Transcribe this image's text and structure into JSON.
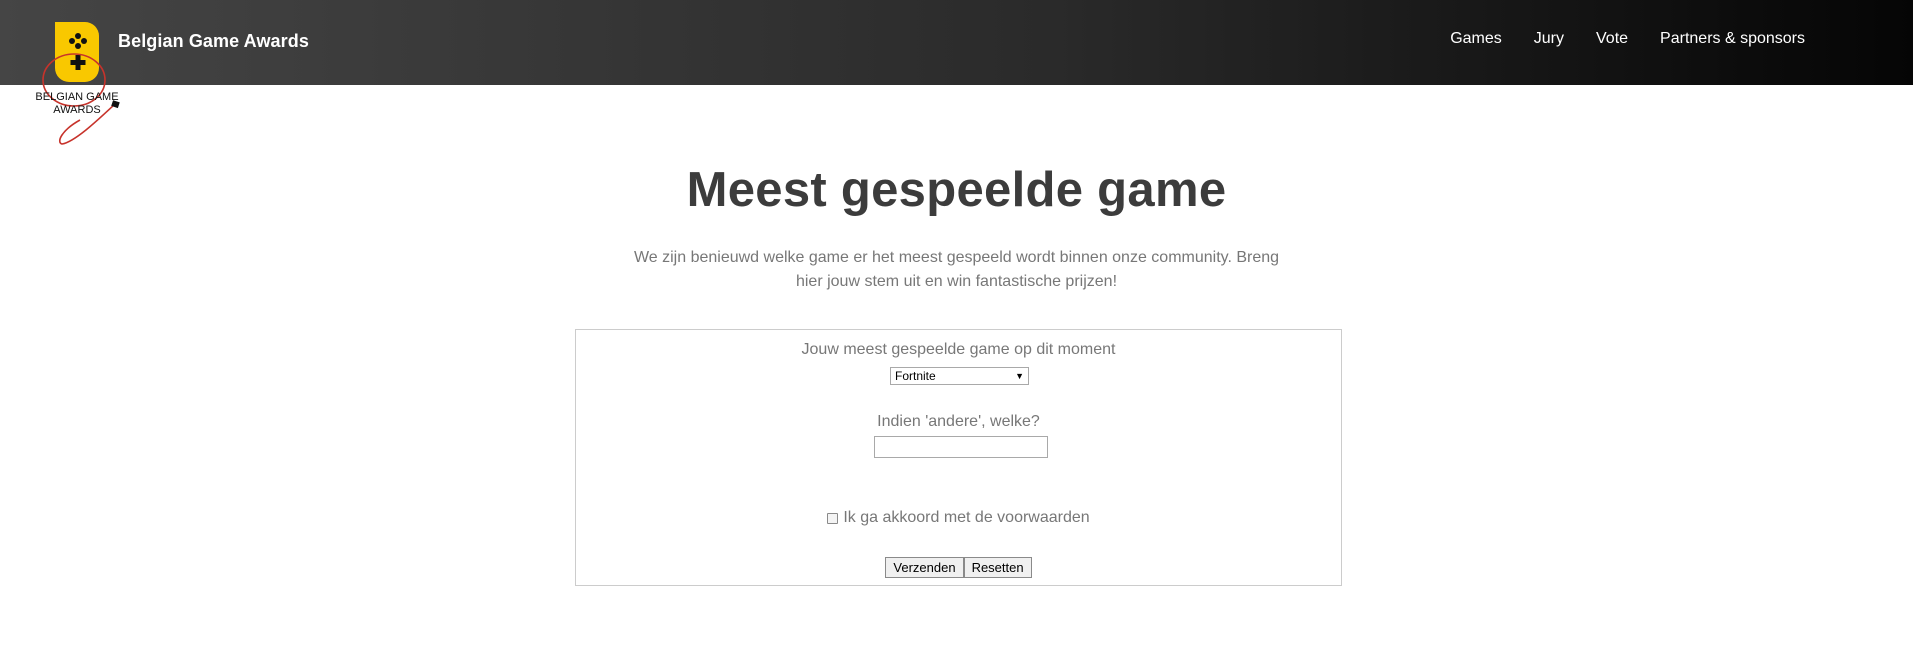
{
  "header": {
    "logo_text": "BELGIAN GAME AWARDS",
    "brand": "Belgian Game Awards",
    "nav": [
      "Games",
      "Jury",
      "Vote",
      "Partners & sponsors"
    ]
  },
  "main": {
    "title": "Meest gespeelde game",
    "intro": "We zijn benieuwd welke game er het meest gespeeld wordt binnen onze community. Breng hier jouw stem uit en win fantastische prijzen!"
  },
  "form": {
    "game_label": "Jouw meest gespeelde game op dit moment",
    "game_selected": "Fortnite",
    "other_label": "Indien 'andere', welke?",
    "other_value": "",
    "terms_label": "Ik ga akkoord met de voorwaarden",
    "submit_label": "Verzenden",
    "reset_label": "Resetten"
  },
  "colors": {
    "logo_yellow": "#f9c800",
    "logo_red": "#c7332b",
    "nav_gradient_start": "#454545",
    "nav_gradient_end": "#050505",
    "heading": "#3c3c3c",
    "body_text": "#777777"
  }
}
